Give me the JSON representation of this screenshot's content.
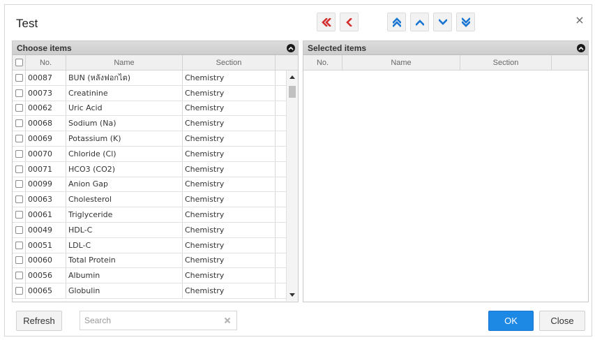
{
  "dialog": {
    "title": "Test",
    "close_glyph": "×"
  },
  "toolbar": {
    "buttons": [
      {
        "name": "move-all-left-button",
        "icon": "double-chevron-left-icon",
        "color": "#d32f2f"
      },
      {
        "name": "move-left-button",
        "icon": "chevron-left-icon",
        "color": "#d32f2f"
      },
      {
        "name": "move-top-button",
        "icon": "double-chevron-up-icon",
        "color": "#1976d2"
      },
      {
        "name": "move-up-button",
        "icon": "chevron-up-icon",
        "color": "#1976d2"
      },
      {
        "name": "move-down-button",
        "icon": "chevron-down-icon",
        "color": "#1976d2"
      },
      {
        "name": "move-bottom-button",
        "icon": "double-chevron-down-icon",
        "color": "#1976d2"
      }
    ]
  },
  "choose": {
    "header": "Choose items",
    "columns": {
      "no": "No.",
      "name": "Name",
      "section": "Section"
    },
    "rows": [
      {
        "no": "00087",
        "name": "BUN (หลังฟอกไต)",
        "section": "Chemistry"
      },
      {
        "no": "00073",
        "name": "Creatinine",
        "section": "Chemistry"
      },
      {
        "no": "00062",
        "name": "Uric Acid",
        "section": "Chemistry"
      },
      {
        "no": "00068",
        "name": "Sodium (Na)",
        "section": "Chemistry"
      },
      {
        "no": "00069",
        "name": "Potassium (K)",
        "section": "Chemistry"
      },
      {
        "no": "00070",
        "name": "Chloride (Cl)",
        "section": "Chemistry"
      },
      {
        "no": "00071",
        "name": "HCO3 (CO2)",
        "section": "Chemistry"
      },
      {
        "no": "00099",
        "name": "Anion Gap",
        "section": "Chemistry"
      },
      {
        "no": "00063",
        "name": "Cholesterol",
        "section": "Chemistry"
      },
      {
        "no": "00061",
        "name": "Triglyceride",
        "section": "Chemistry"
      },
      {
        "no": "00049",
        "name": "HDL-C",
        "section": "Chemistry"
      },
      {
        "no": "00051",
        "name": "LDL-C",
        "section": "Chemistry"
      },
      {
        "no": "00060",
        "name": "Total Protein",
        "section": "Chemistry"
      },
      {
        "no": "00056",
        "name": "Albumin",
        "section": "Chemistry"
      },
      {
        "no": "00065",
        "name": "Globulin",
        "section": "Chemistry"
      }
    ]
  },
  "selected": {
    "header": "Selected items",
    "columns": {
      "no": "No.",
      "name": "Name",
      "section": "Section"
    }
  },
  "footer": {
    "refresh_label": "Refresh",
    "search_placeholder": "Search",
    "ok_label": "OK",
    "close_label": "Close"
  },
  "colors": {
    "ok_button": "#1e88e5",
    "move_left": "#d32f2f",
    "reorder": "#1976d2"
  }
}
